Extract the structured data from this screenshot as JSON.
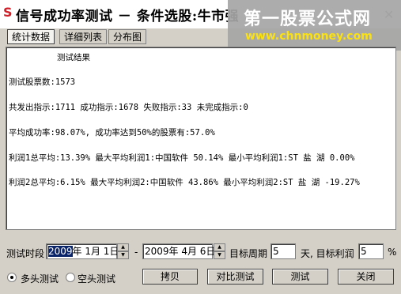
{
  "window": {
    "title": "信号成功率测试 － 条件选股:牛市强"
  },
  "watermark": {
    "line1": "第一股票公式网",
    "line2": "www.chnmoney.com"
  },
  "tabs": [
    {
      "label": "统计数据"
    },
    {
      "label": "详细列表"
    },
    {
      "label": "分布图"
    }
  ],
  "results": {
    "heading": "测试结果",
    "lines": [
      "测试股票数:1573",
      "共发出指示:1711 成功指示:1678 失败指示:33 未完成指示:0",
      "平均成功率:98.07%, 成功率达到50%的股票有:57.0%",
      "利润1总平均:13.39% 最大平均利润1:中国软件 50.14% 最小平均利润1:ST 盐 湖 0.00%",
      "利润2总平均:6.15% 最大平均利润2:中国软件 43.86% 最小平均利润2:ST 盐 湖 -19.27%"
    ]
  },
  "controls": {
    "period_label": "测试时段",
    "start_year": "2009",
    "start_rest": "年  1月  1日",
    "dash": "-",
    "end_date": "2009年  4月  6日",
    "target_period_label": "目标周期",
    "target_period_value": "5",
    "target_profit_label": "天, 目标利润",
    "target_profit_value": "5",
    "percent": "%",
    "radio_long": "多头测试",
    "radio_short": "空头测试",
    "btn_copy": "拷贝",
    "btn_compare": "对比测试",
    "btn_test": "测试",
    "btn_close": "关闭"
  }
}
